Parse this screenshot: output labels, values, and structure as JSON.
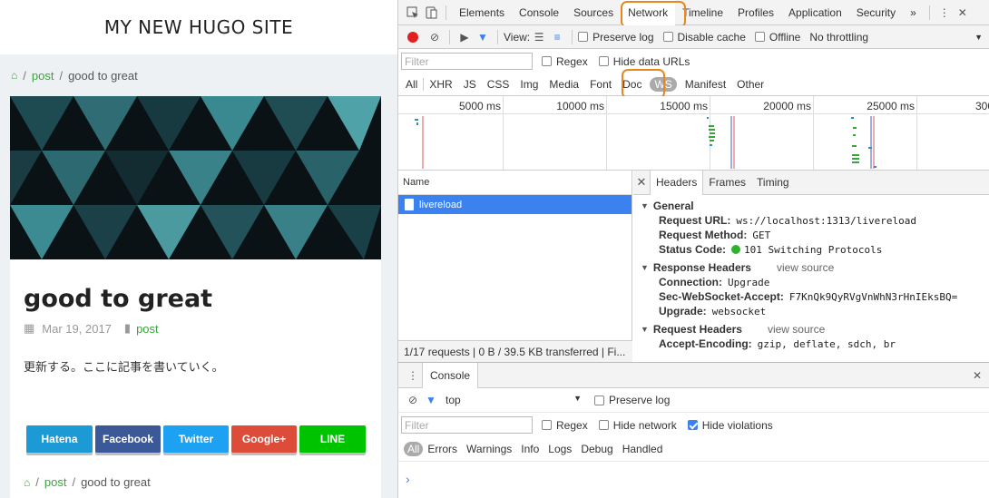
{
  "site": {
    "title": "MY NEW HUGO SITE",
    "breadcrumb": {
      "section": "post",
      "current": "good to great"
    },
    "post": {
      "title": "good to great",
      "date": "Mar 19, 2017",
      "tag": "post",
      "body": "更新する。ここに記事を書いていく。"
    },
    "share": [
      {
        "label": "Hatena",
        "color": "#1b9ad6"
      },
      {
        "label": "Facebook",
        "color": "#3b5998"
      },
      {
        "label": "Twitter",
        "color": "#1da1f2"
      },
      {
        "label": "Google+",
        "color": "#dd4b39"
      },
      {
        "label": "LINE",
        "color": "#00c300"
      }
    ]
  },
  "devtools": {
    "tabs": [
      "Elements",
      "Console",
      "Sources",
      "Network",
      "Timeline",
      "Profiles",
      "Application",
      "Security"
    ],
    "active_tab": "Network",
    "more": "»",
    "toolbar": {
      "view_label": "View:",
      "preserve_log": "Preserve log",
      "disable_cache": "Disable cache",
      "offline": "Offline",
      "throttle": "No throttling"
    },
    "filter": {
      "placeholder": "Filter",
      "regex": "Regex",
      "hide_data_urls": "Hide data URLs"
    },
    "types": [
      "All",
      "XHR",
      "JS",
      "CSS",
      "Img",
      "Media",
      "Font",
      "Doc",
      "WS",
      "Manifest",
      "Other"
    ],
    "active_type": "WS",
    "ruler": [
      "5000 ms",
      "10000 ms",
      "15000 ms",
      "20000 ms",
      "25000 ms",
      "300"
    ],
    "name_header": "Name",
    "requests": [
      {
        "name": "livereload"
      }
    ],
    "summary": "1/17 requests  |  0 B / 39.5 KB transferred  |  Fi...",
    "detail_tabs": [
      "Headers",
      "Frames",
      "Timing"
    ],
    "general": {
      "title": "General",
      "url_k": "Request URL:",
      "url_v": "ws://localhost:1313/livereload",
      "method_k": "Request Method:",
      "method_v": "GET",
      "status_k": "Status Code:",
      "status_v": "101 Switching Protocols"
    },
    "response_headers": {
      "title": "Response Headers",
      "view_source": "view source",
      "conn_k": "Connection:",
      "conn_v": "Upgrade",
      "accept_k": "Sec-WebSocket-Accept:",
      "accept_v": "F7KnQk9QyRVgVnWhN3rHnIEksBQ=",
      "upgrade_k": "Upgrade:",
      "upgrade_v": "websocket"
    },
    "request_headers": {
      "title": "Request Headers",
      "view_source": "view source",
      "enc_k": "Accept-Encoding:",
      "enc_v": "gzip, deflate, sdch, br"
    },
    "console": {
      "tab": "Console",
      "context": "top",
      "preserve_log": "Preserve log",
      "filter_placeholder": "Filter",
      "regex": "Regex",
      "hide_network": "Hide network",
      "hide_violations": "Hide violations",
      "levels": [
        "All",
        "Errors",
        "Warnings",
        "Info",
        "Logs",
        "Debug",
        "Handled"
      ],
      "prompt": "›"
    }
  }
}
